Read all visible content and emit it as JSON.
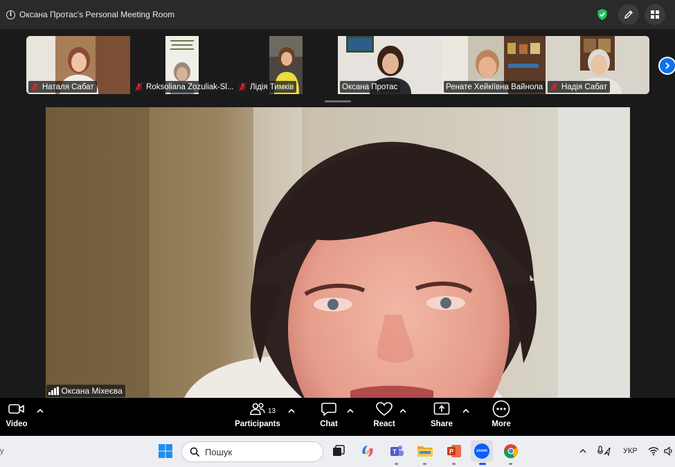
{
  "window": {
    "title": "Оксана Протас's Personal Meeting Room"
  },
  "gallery": {
    "participants": [
      {
        "name": "Наталя Сабат",
        "muted": true
      },
      {
        "name": "Roksoliana Zozuliak-Sl...",
        "muted": true
      },
      {
        "name": "Лідія Тимків",
        "muted": true
      },
      {
        "name": "Оксана Протас",
        "muted": false
      },
      {
        "name": "Ренате Хейкіївна Вайнола",
        "muted": false
      },
      {
        "name": "Надія Сабат",
        "muted": true
      }
    ]
  },
  "main_speaker": {
    "name": "Оксана Міхеєва"
  },
  "controls": {
    "video_label": "Video",
    "participants_label": "Participants",
    "participants_count": "13",
    "chat_label": "Chat",
    "react_label": "React",
    "share_label": "Share",
    "more_label": "More"
  },
  "taskbar": {
    "search_placeholder": "Пошук",
    "language": "УКР",
    "left_edge_text": "у",
    "zoom_app_text": "zoom"
  },
  "colors": {
    "accent_blue": "#0e72ed",
    "shield_green": "#22c55e",
    "muted_red": "#e02828"
  }
}
